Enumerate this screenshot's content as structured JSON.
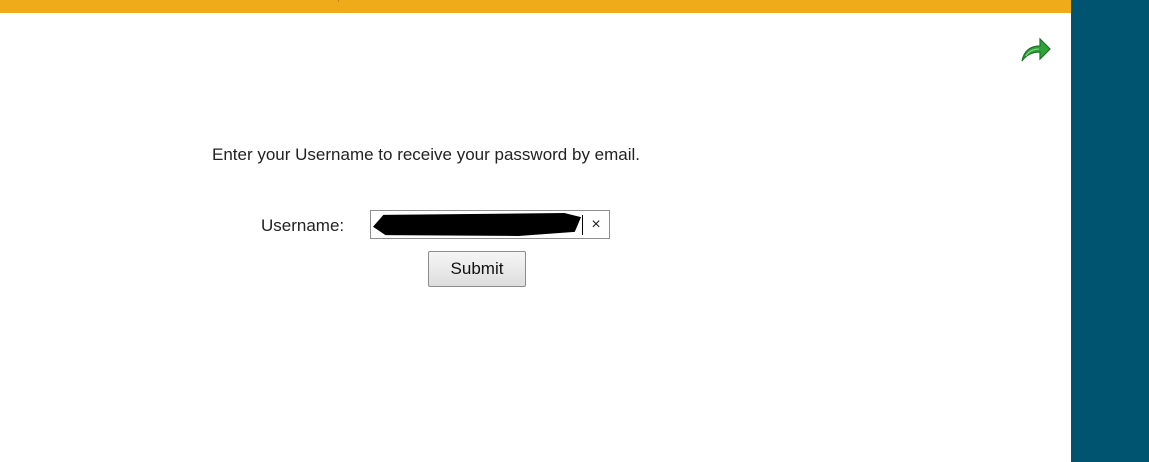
{
  "header": {
    "accent_color": "#f0ab1a"
  },
  "sidebar": {
    "background_color": "#005470"
  },
  "toolbar": {
    "forward_icon": "green-forward-arrow-icon",
    "forward_icon_color": "#2fa33a"
  },
  "form": {
    "instruction": "Enter your Username to receive your password by email.",
    "username_label": "Username:",
    "username_value": "",
    "username_redacted": true,
    "clear_label": "×",
    "submit_label": "Submit"
  }
}
